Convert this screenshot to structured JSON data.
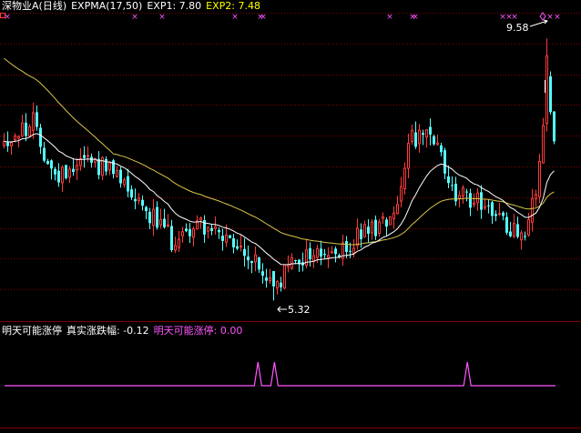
{
  "colors": {
    "background": "#000000",
    "grid": "#800000",
    "up": "#ff3b3b",
    "down": "#54ffff",
    "exp1": "#ffffff",
    "exp2": "#d7c64a",
    "title": "#ffffff",
    "exp2_label": "#ffff00",
    "signal": "#ff55ff"
  },
  "main_panel": {
    "stock_name": "深物业A(日线)",
    "indicator_name": "EXPMA(17,50)",
    "exp1_label": "EXP1: 7.80",
    "exp2_label": "EXP2: 7.48",
    "high_marker": "9.58",
    "low_marker": "5.32",
    "limit_up_glyph": "×"
  },
  "sub_panel": {
    "indicator_title": "明天可能涨停",
    "real_change_label": "真实涨跌幅: -0.12",
    "signal_label": "明天可能涨停: 0.00"
  },
  "chart_data": {
    "type": "candlestick",
    "series": [
      {
        "name": "EXP1",
        "values": [
          7.8
        ]
      },
      {
        "name": "EXP2",
        "values": [
          7.48
        ]
      }
    ],
    "price_range": [
      5.3,
      9.6
    ],
    "high": 9.58,
    "low": 5.32,
    "sub_indicator": {
      "name": "明天可能涨停",
      "last_value": 0.0,
      "spikes_at_fraction": [
        0.46,
        0.49,
        0.84
      ]
    }
  }
}
